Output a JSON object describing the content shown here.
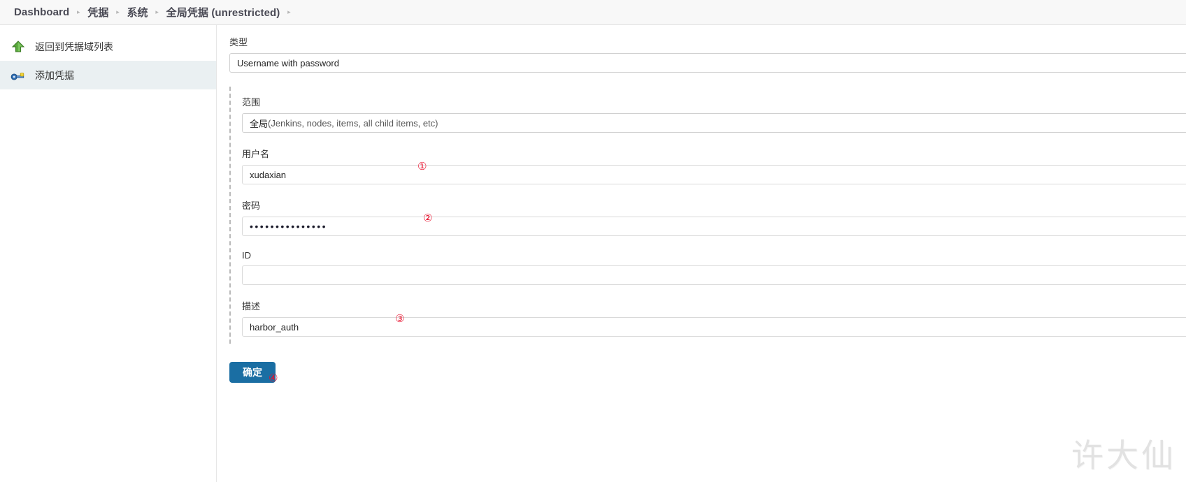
{
  "breadcrumb": {
    "items": [
      {
        "label": "Dashboard"
      },
      {
        "label": "凭据"
      },
      {
        "label": "系统"
      },
      {
        "label": "全局凭据 (unrestricted)"
      }
    ],
    "separator": "▸"
  },
  "sidebar": {
    "items": [
      {
        "label": "返回到凭据域列表",
        "icon": "up-arrow-icon",
        "selected": false
      },
      {
        "label": "添加凭据",
        "icon": "key-icon",
        "selected": true
      }
    ]
  },
  "form": {
    "type": {
      "label": "类型",
      "value": "Username with password",
      "options": [
        "Username with password"
      ]
    },
    "scope": {
      "label": "范围",
      "value_main": "全局",
      "value_note": " (Jenkins, nodes, items, all child items, etc)",
      "options": [
        "全局 (Jenkins, nodes, items, all child items, etc)"
      ]
    },
    "username": {
      "label": "用户名",
      "value": "xudaxian",
      "placeholder": "",
      "annotation": "①"
    },
    "password": {
      "label": "密码",
      "value": "•••••••••••••••",
      "placeholder": "",
      "annotation": "②"
    },
    "id": {
      "label": "ID",
      "value": "",
      "placeholder": ""
    },
    "description": {
      "label": "描述",
      "value": "harbor_auth",
      "placeholder": "",
      "annotation": "③"
    },
    "submit": {
      "label": "确定",
      "annotation": "④",
      "color": "#1a6ea3"
    }
  },
  "watermark": {
    "text": "许大仙"
  },
  "colors": {
    "accent": "#1a6ea3",
    "annotation": "#e8112d",
    "sidebar_selected": "#eaf0f2",
    "header_bg": "#f8f8f8"
  }
}
